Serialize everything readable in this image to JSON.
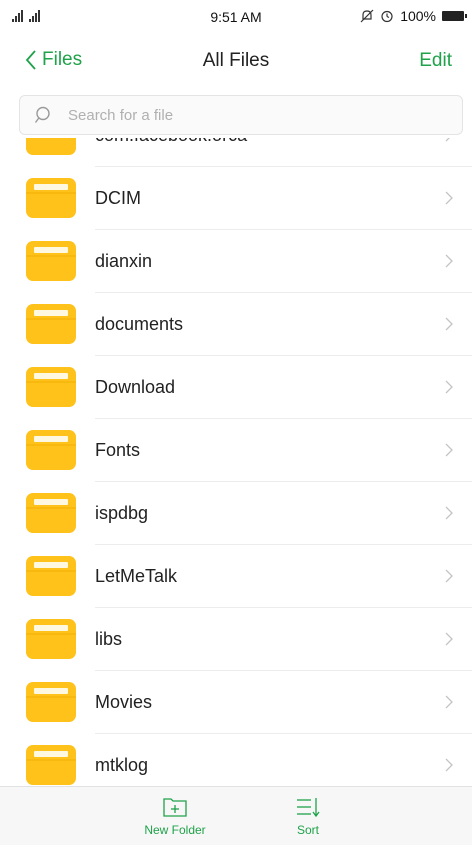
{
  "status_bar": {
    "time": "9:51 AM",
    "battery": "100%",
    "icons": [
      "signal-icon",
      "mute-icon",
      "alarm-icon",
      "battery-icon"
    ]
  },
  "nav": {
    "back_label": "Files",
    "title": "All Files",
    "edit_label": "Edit"
  },
  "search": {
    "placeholder": "Search for a file"
  },
  "files": [
    {
      "name": "com.facebook.orca"
    },
    {
      "name": "DCIM"
    },
    {
      "name": "dianxin"
    },
    {
      "name": "documents"
    },
    {
      "name": "Download"
    },
    {
      "name": "Fonts"
    },
    {
      "name": "ispdbg"
    },
    {
      "name": "LetMeTalk"
    },
    {
      "name": "libs"
    },
    {
      "name": "Movies"
    },
    {
      "name": "mtklog"
    }
  ],
  "toolbar": {
    "new_folder_label": "New Folder",
    "sort_label": "Sort"
  },
  "colors": {
    "accent": "#1fa24a",
    "folder": "#ffc21a"
  }
}
